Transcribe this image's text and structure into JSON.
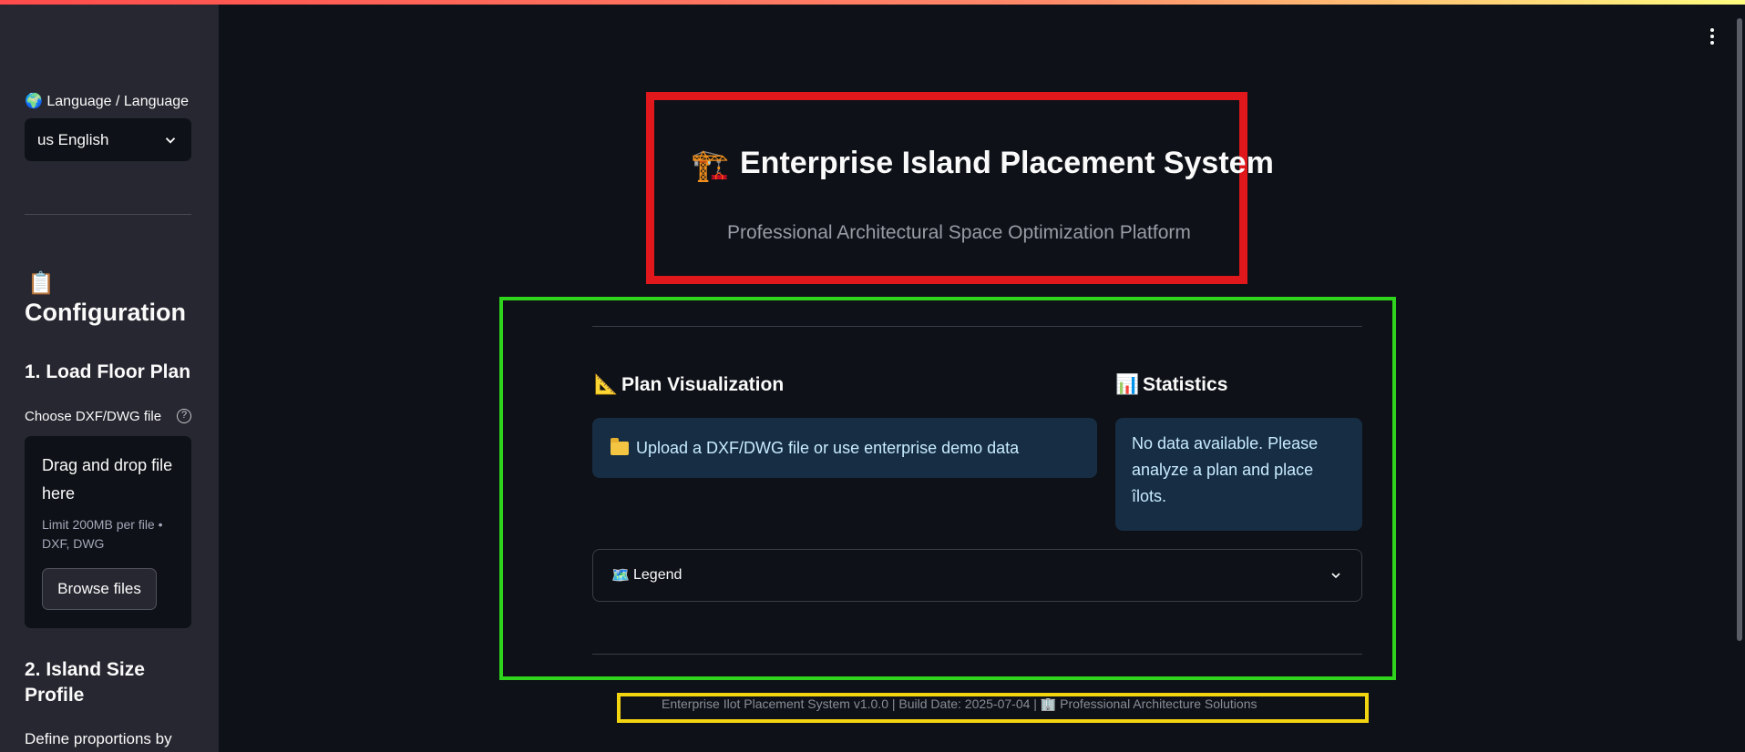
{
  "sidebar": {
    "language_label": "🌍 Language / Language",
    "language_selected": "us English",
    "config_icon": "clipboard-icon",
    "config_title": "Configuration",
    "step1_title": "1. Load Floor Plan",
    "choose_label": "Choose DXF/DWG file",
    "dropzone_title": "Drag and drop file here",
    "dropzone_limit": "Limit 200MB per file • DXF, DWG",
    "browse_label": "Browse files",
    "step2_title": "2. Island Size Profile",
    "define_text": "Define proportions by"
  },
  "header": {
    "title": "Enterprise Island Placement System",
    "subtitle": "Professional Architectural Space Optimization Platform",
    "icon": "construction-crane-icon"
  },
  "main": {
    "plan_heading": "Plan Visualization",
    "stats_heading": "Statistics",
    "upload_info": "Upload a DXF/DWG file or use enterprise demo data",
    "stats_info": "No data available. Please analyze a plan and place îlots.",
    "legend_label": "Legend"
  },
  "footer": {
    "text": "Enterprise Ilot Placement System v1.0.0 | Build Date: 2025-07-04 | 🏢 Professional Architecture Solutions"
  },
  "colors": {
    "background": "#0e1117",
    "sidebar": "#262730",
    "info_bg": "#172d43",
    "info_text": "#c7ebff",
    "header_outline": "#e0181c",
    "content_outline": "#2fd41c",
    "footer_outline": "#f2d411"
  }
}
